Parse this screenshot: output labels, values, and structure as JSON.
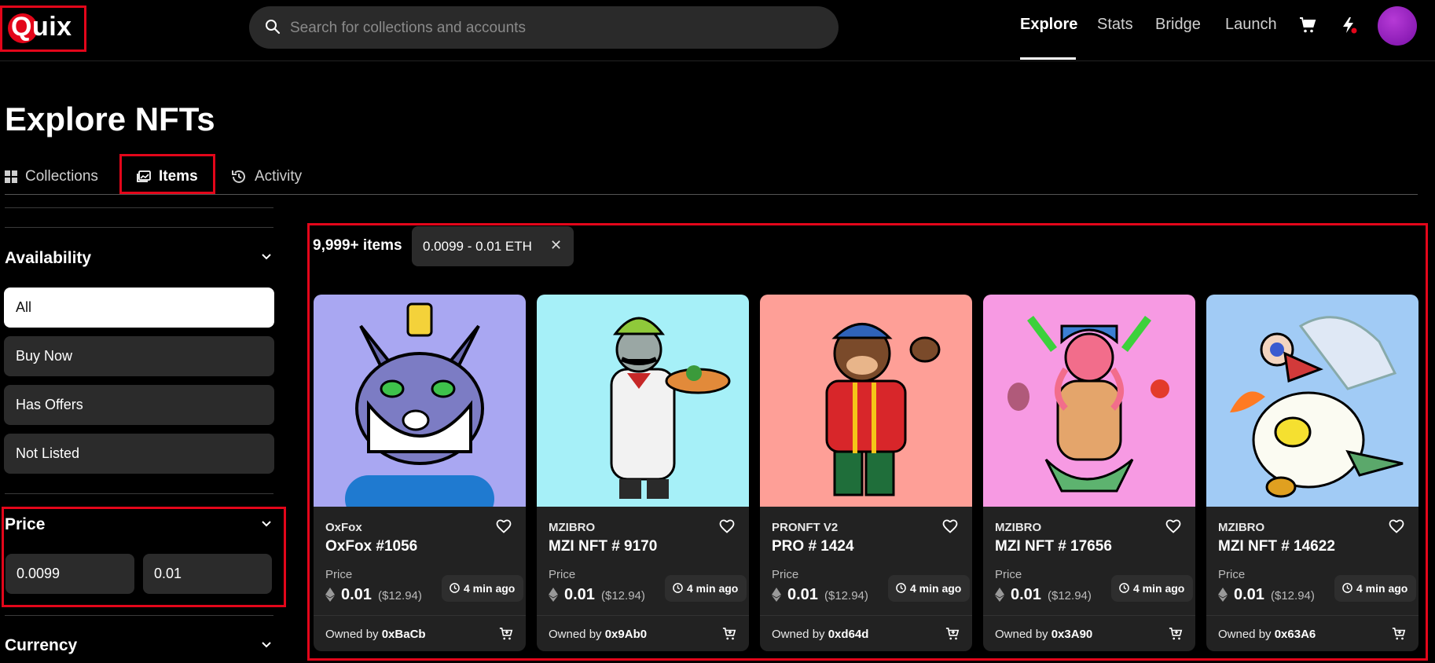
{
  "header": {
    "logo_text": "Quix",
    "search_placeholder": "Search for collections and accounts",
    "nav": [
      "Explore",
      "Stats",
      "Bridge",
      "Launch"
    ],
    "active_nav": "Explore"
  },
  "page": {
    "title": "Explore NFTs",
    "tabs": [
      "Collections",
      "Items",
      "Activity"
    ],
    "active_tab": "Items"
  },
  "sidebar": {
    "availability": {
      "title": "Availability",
      "options": [
        "All",
        "Buy Now",
        "Has Offers",
        "Not Listed"
      ],
      "selected": "All"
    },
    "price": {
      "title": "Price",
      "min": "0.0099",
      "max": "0.01"
    },
    "currency": {
      "title": "Currency"
    }
  },
  "results": {
    "count": "9,999+ items",
    "filter_chip": "0.0099 - 0.01 ETH",
    "price_label": "Price",
    "owned_prefix": "Owned by",
    "cards": [
      {
        "collection": "OxFox",
        "name": "OxFox #1056",
        "price": "0.01",
        "usd": "($12.94)",
        "time": "4 min ago",
        "owner": "0xBaCb",
        "bg": "#a9a7f2"
      },
      {
        "collection": "MZIBRO",
        "name": "MZI NFT # 9170",
        "price": "0.01",
        "usd": "($12.94)",
        "time": "4 min ago",
        "owner": "0x9Ab0",
        "bg": "#a6f0f8"
      },
      {
        "collection": "PRONFT V2",
        "name": "PRO # 1424",
        "price": "0.01",
        "usd": "($12.94)",
        "time": "4 min ago",
        "owner": "0xd64d",
        "bg": "#fe9f97"
      },
      {
        "collection": "MZIBRO",
        "name": "MZI NFT # 17656",
        "price": "0.01",
        "usd": "($12.94)",
        "time": "4 min ago",
        "owner": "0x3A90",
        "bg": "#f79ae3"
      },
      {
        "collection": "MZIBRO",
        "name": "MZI NFT # 14622",
        "price": "0.01",
        "usd": "($12.94)",
        "time": "4 min ago",
        "owner": "0x63A6",
        "bg": "#a1cbf5"
      }
    ]
  },
  "colors": {
    "accent_red": "#e3061a",
    "card_bg": "#222222",
    "avatar": "#9b1fc4"
  }
}
